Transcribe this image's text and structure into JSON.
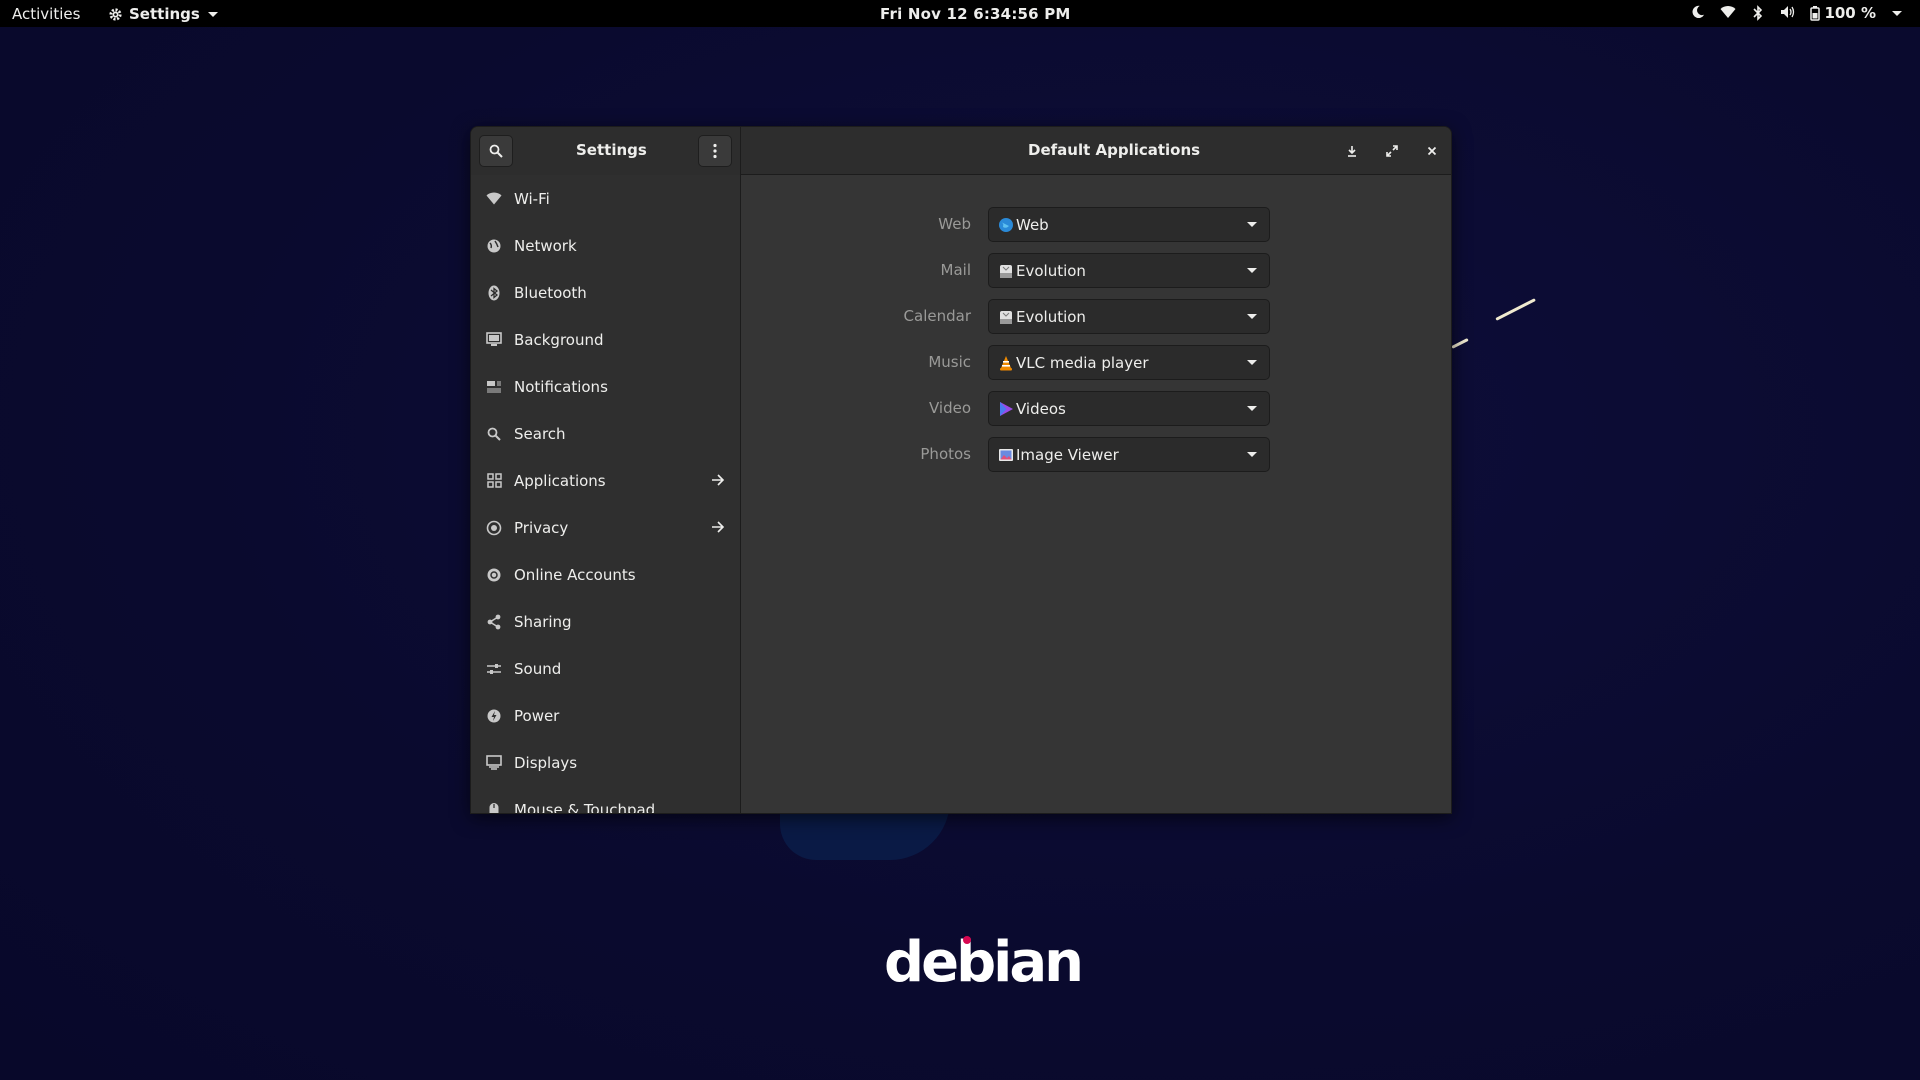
{
  "topbar": {
    "activities": "Activities",
    "app_menu": "Settings",
    "clock": "Fri Nov 12  6:34:56 PM",
    "battery": "100 %"
  },
  "window": {
    "sidebar_title": "Settings",
    "content_title": "Default Applications"
  },
  "sidebar": {
    "items": [
      {
        "label": "Wi-Fi",
        "icon": "wifi-icon"
      },
      {
        "label": "Network",
        "icon": "network-icon"
      },
      {
        "label": "Bluetooth",
        "icon": "bluetooth-icon"
      },
      {
        "label": "Background",
        "icon": "background-icon"
      },
      {
        "label": "Notifications",
        "icon": "notifications-icon"
      },
      {
        "label": "Search",
        "icon": "search-icon"
      },
      {
        "label": "Applications",
        "icon": "applications-icon",
        "arrow": true
      },
      {
        "label": "Privacy",
        "icon": "privacy-icon",
        "arrow": true
      },
      {
        "label": "Online Accounts",
        "icon": "online-accounts-icon"
      },
      {
        "label": "Sharing",
        "icon": "sharing-icon"
      },
      {
        "label": "Sound",
        "icon": "sound-icon"
      },
      {
        "label": "Power",
        "icon": "power-icon"
      },
      {
        "label": "Displays",
        "icon": "displays-icon"
      },
      {
        "label": "Mouse & Touchpad",
        "icon": "mouse-icon"
      }
    ]
  },
  "defaults": [
    {
      "label": "Web",
      "value": "Web",
      "icon": "web-browser-icon"
    },
    {
      "label": "Mail",
      "value": "Evolution",
      "icon": "evolution-icon"
    },
    {
      "label": "Calendar",
      "value": "Evolution",
      "icon": "evolution-icon"
    },
    {
      "label": "Music",
      "value": "VLC media player",
      "icon": "vlc-icon"
    },
    {
      "label": "Video",
      "value": "Videos",
      "icon": "videos-icon"
    },
    {
      "label": "Photos",
      "value": "Image Viewer",
      "icon": "image-viewer-icon"
    }
  ],
  "desktop": {
    "logo_text": "debian"
  },
  "colors": {
    "desktop_bg": "#0a0a2e",
    "window_bg": "#353535",
    "sidebar_bg": "#2f2f2f",
    "debian_red": "#d70751"
  }
}
